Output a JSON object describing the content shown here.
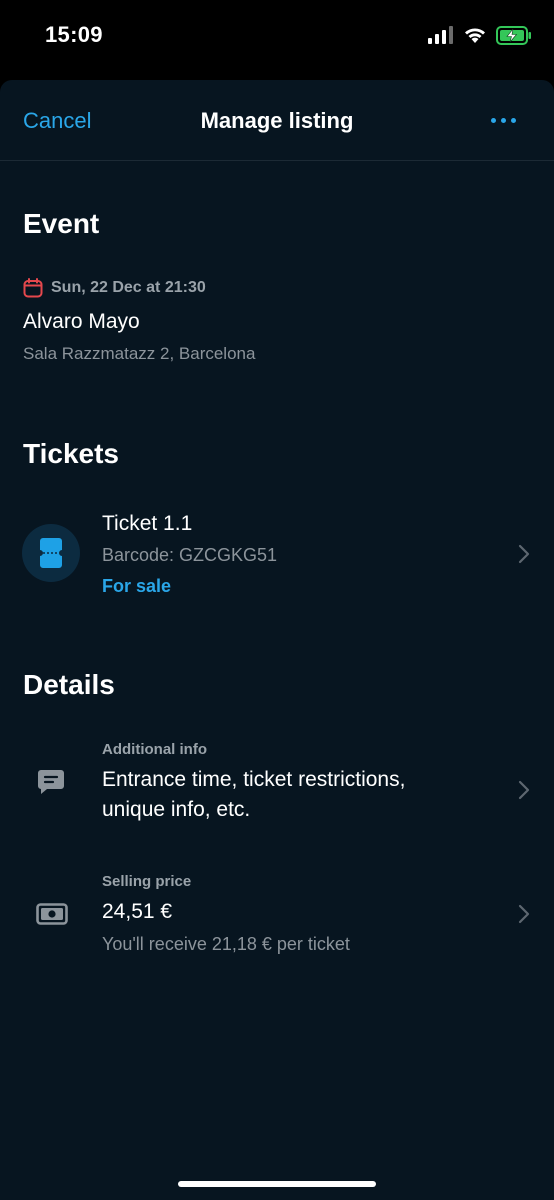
{
  "status_bar": {
    "time": "15:09"
  },
  "nav": {
    "cancel_label": "Cancel",
    "title": "Manage listing"
  },
  "event": {
    "section_title": "Event",
    "date": "Sun, 22 Dec at 21:30",
    "name": "Alvaro Mayo",
    "venue": "Sala Razzmatazz 2, Barcelona"
  },
  "tickets": {
    "section_title": "Tickets",
    "items": [
      {
        "name": "Ticket 1.1",
        "barcode": "Barcode: GZCGKG51",
        "status": "For sale"
      }
    ]
  },
  "details": {
    "section_title": "Details",
    "additional_info": {
      "label": "Additional info",
      "line1": "Entrance time, ticket restrictions,",
      "line2": "unique info, etc."
    },
    "selling_price": {
      "label": "Selling price",
      "value": "24,51 €",
      "note": "You'll receive 21,18 € per ticket"
    }
  },
  "colors": {
    "accent": "#2aa6e8",
    "background": "#071520",
    "calendar_icon": "#e5484d",
    "battery": "#34c759"
  },
  "icons": [
    "calendar-icon",
    "ticket-icon",
    "chat-icon",
    "cash-icon",
    "chevron-right-icon",
    "more-icon",
    "signal-icon",
    "wifi-icon",
    "battery-charging-icon"
  ]
}
